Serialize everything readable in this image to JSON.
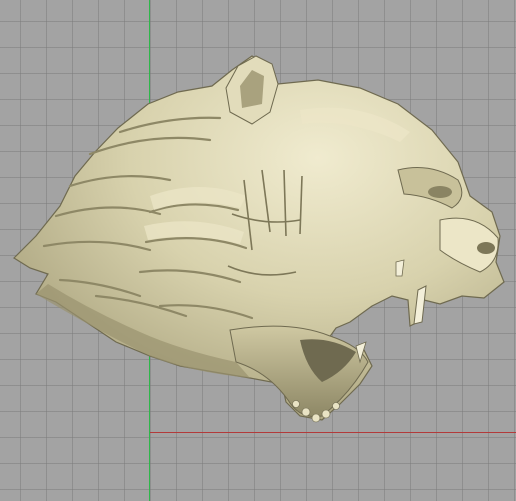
{
  "viewport": {
    "background_color": "#a3a3a3",
    "grid_color": "#7d7d7d",
    "axes": {
      "x_axis_color": "#b23a3a",
      "y_axis_color": "#2eb84a"
    }
  },
  "model": {
    "icon": "tiger-head-sculpture",
    "base_color": "#d8d2ad",
    "shadow_color": "#8e8866"
  }
}
